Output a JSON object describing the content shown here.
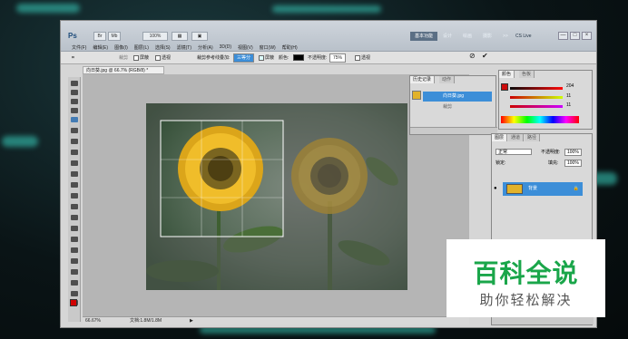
{
  "app": {
    "logo": "Ps"
  },
  "menus": [
    "文件(F)",
    "编辑(E)",
    "图像(I)",
    "图层(L)",
    "选择(S)",
    "滤镜(T)",
    "分析(A)",
    "3D(D)",
    "视图(V)",
    "窗口(W)",
    "帮助(H)"
  ],
  "topbar": {
    "essentials": "基本功能",
    "workspaces": [
      "设计",
      "绘画",
      "摄影",
      ">>"
    ],
    "cslive": "CS Live",
    "win_controls": [
      "—",
      "□",
      "×"
    ]
  },
  "options": {
    "crop_label": "裁剪",
    "shield_label": "屏蔽",
    "perspective_label": "透视",
    "overlay_label": "裁剪参考线叠加:",
    "overlay_value": "三等分",
    "shield_check_label": "屏蔽",
    "color_label": "颜色:",
    "opacity_label": "不透明度:",
    "opacity_value": "75%",
    "perspective_check": "透视",
    "cancel_icon": "⊘",
    "commit_icon": "✔"
  },
  "document": {
    "tab_title": "向日葵.jpg @ 66.7% (RGB/8) *",
    "zoom": "66.67%",
    "doc_size": "文档:1.8M/1.8M"
  },
  "history_panel": {
    "tabs": [
      "历史记录",
      "动作"
    ],
    "items": [
      "向日葵.jpg",
      "裁剪"
    ]
  },
  "color_panel": {
    "tabs": [
      "颜色",
      "色板"
    ],
    "values": [
      "204",
      "11",
      "11"
    ]
  },
  "layers_panel": {
    "tabs": [
      "图层",
      "通道",
      "路径"
    ],
    "blend_mode": "正常",
    "opacity_label": "不透明度:",
    "opacity_value": "100%",
    "lock_label": "锁定:",
    "fill_label": "填充:",
    "fill_value": "100%",
    "layer_name": "背景"
  },
  "watermark": {
    "title": "百科全说",
    "subtitle": "助你轻松解决"
  },
  "colors": {
    "accent": "#3c8ed8",
    "watermark_green": "#1aa64a",
    "foreground": "#d10000"
  }
}
